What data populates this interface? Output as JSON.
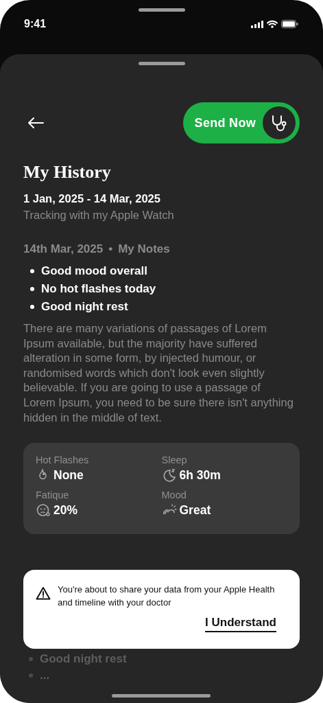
{
  "status_bar": {
    "time": "9:41"
  },
  "header": {
    "send_button": "Send Now"
  },
  "title": "My History",
  "date_range": "1 Jan, 2025 - 14 Mar, 2025",
  "subtitle": "Tracking with my Apple Watch",
  "note": {
    "date": "14th Mar, 2025",
    "separator": "•",
    "label": "My Notes",
    "bullets": [
      "Good mood overall",
      "No hot flashes today",
      "Good night rest"
    ],
    "body": "There are many variations of passages of Lorem Ipsum available, but the majority have suffered alteration in some form, by injected humour, or randomised words which don't look even slightly believable. If you are going to use a passage of Lorem Ipsum, you need to be sure there isn't anything hidden in the middle of text."
  },
  "stats": [
    {
      "label": "Hot Flashes",
      "value": "None",
      "kind": "flame"
    },
    {
      "label": "Sleep",
      "value": "6h 30m",
      "kind": "moon"
    },
    {
      "label": "Fatique",
      "value": "20%",
      "kind": "tired"
    },
    {
      "label": "Mood",
      "value": "Great",
      "kind": "weather"
    }
  ],
  "faded_bullets": [
    "Good night rest",
    "..."
  ],
  "toast": {
    "message": "You're about to share your data from your Apple Health and timeline with your doctor",
    "action": "I Understand"
  }
}
